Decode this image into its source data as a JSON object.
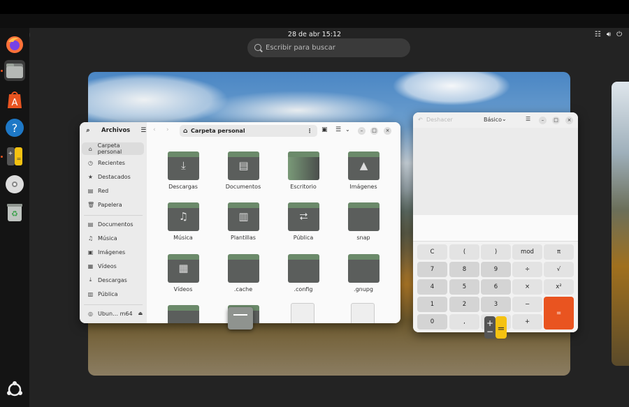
{
  "topbar": {
    "datetime": "28 de abr  15:12"
  },
  "search": {
    "placeholder": "Escribir para buscar"
  },
  "dock": {
    "items": [
      "firefox-icon",
      "files-icon",
      "app-center-icon",
      "help-icon",
      "calculator-icon",
      "disc-icon",
      "trash-icon",
      "ubuntu-logo"
    ]
  },
  "files": {
    "app_title": "Archivos",
    "location": "Carpeta personal",
    "sidebar": {
      "places": [
        "Carpeta personal",
        "Recientes",
        "Destacados",
        "Red",
        "Papelera"
      ],
      "bookmarks": [
        "Documentos",
        "Música",
        "Imágenes",
        "Vídeos",
        "Descargas",
        "Pública"
      ],
      "device": "Ubun… m64"
    },
    "folders": [
      "Descargas",
      "Documentos",
      "Escritorio",
      "Imágenes",
      "Música",
      "Plantillas",
      "Pública",
      "snap",
      "Vídeos",
      ".cache",
      ".config",
      ".gnupg"
    ]
  },
  "calc": {
    "undo": "Deshacer",
    "mode": "Básico",
    "keys": [
      [
        "C",
        "(",
        ")",
        "mod",
        "π"
      ],
      [
        "7",
        "8",
        "9",
        "÷",
        "√"
      ],
      [
        "4",
        "5",
        "6",
        "×",
        "x²"
      ],
      [
        "1",
        "2",
        "3",
        "−",
        ""
      ],
      [
        "0",
        ",",
        "%",
        "+",
        "="
      ]
    ]
  }
}
